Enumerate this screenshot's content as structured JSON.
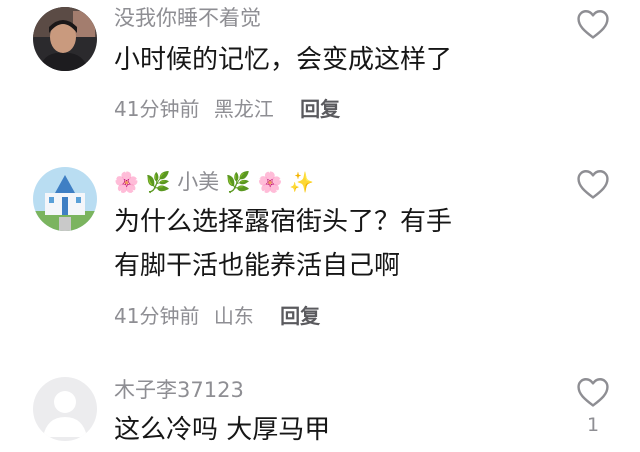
{
  "comments": [
    {
      "username": "没我你睡不着觉",
      "content_lines": [
        "小时候的记忆，会变成这样了"
      ],
      "time": "41分钟前",
      "location": "黑龙江",
      "reply_label": "回复"
    },
    {
      "username_parts": [
        "🌸",
        "🌿",
        "小美",
        "🌿",
        "🌸",
        "✨"
      ],
      "content_lines": [
        "为什么选择露宿街头了？有手",
        "有脚干活也能养活自己啊"
      ],
      "time": "41分钟前",
      "location": "山东",
      "reply_label": "回复"
    },
    {
      "username": "木子李37123",
      "content_lines": [
        "这么冷吗  大厚马甲"
      ],
      "like_count": "1"
    }
  ],
  "icons": {
    "like": "heart-outline-icon",
    "default_avatar": "default-avatar-icon"
  },
  "colors": {
    "text_primary": "#161616",
    "text_secondary": "#8e8e93",
    "reply": "#5a5a5e"
  }
}
